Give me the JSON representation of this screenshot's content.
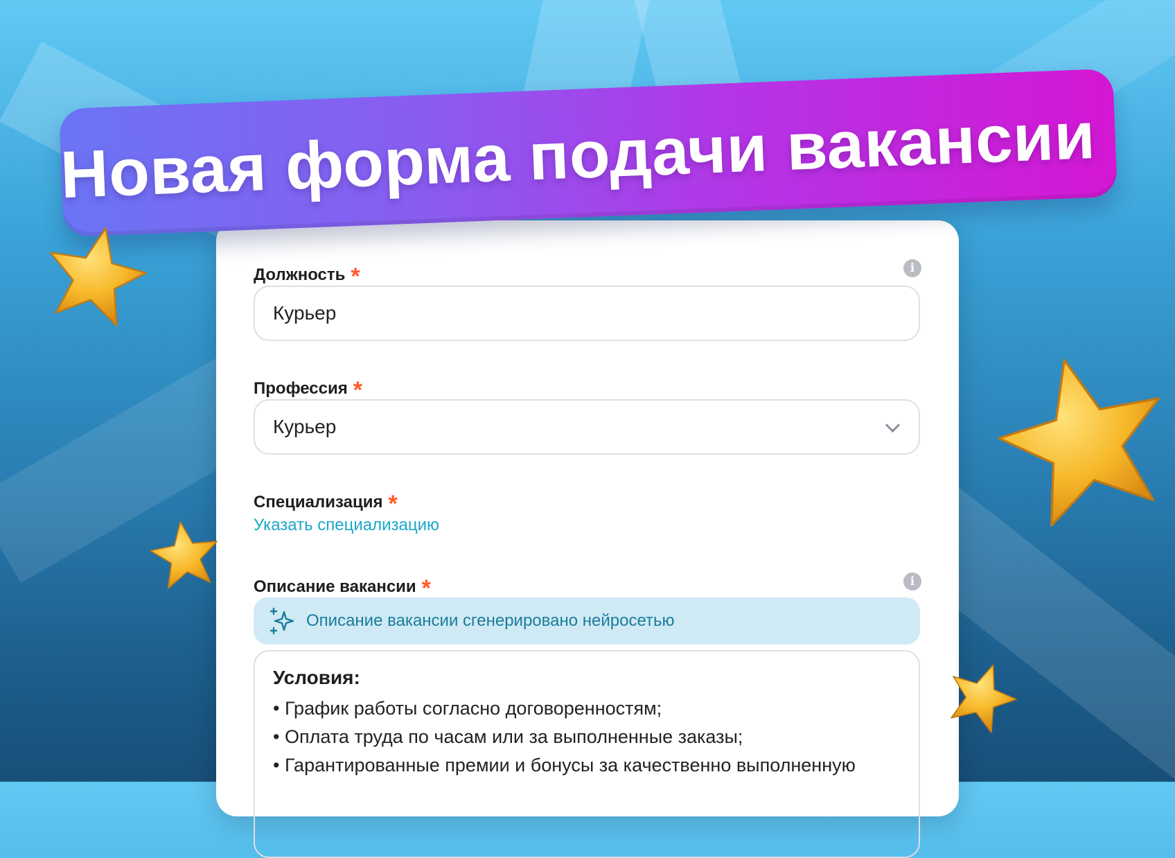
{
  "headline": "Новая форма подачи вакансии",
  "form": {
    "position": {
      "label": "Должность",
      "required": "*",
      "value": "Курьер",
      "info_icon": "i"
    },
    "profession": {
      "label": "Профессия",
      "required": "*",
      "value": "Курьер"
    },
    "specialization": {
      "label": "Специализация",
      "required": "*",
      "link": "Указать специализацию"
    },
    "description": {
      "label": "Описание вакансии",
      "required": "*",
      "info_icon": "i",
      "ai_notice": "Описание вакансии сгенерировано нейросетью",
      "heading": "Условия:",
      "lines": [
        "• График работы согласно договоренностям;",
        "• Оплата труда по часам или за выполненные заказы;",
        "• Гарантированные премии и бонусы за качественно выполненную"
      ]
    }
  },
  "colors": {
    "banner_start": "#6b74f4",
    "banner_end": "#d417d3",
    "required_star": "#ff5a2a",
    "link": "#1aa6c9",
    "ai_notice_bg": "#cfeaf4",
    "star_fill": "#f7b92b"
  },
  "icons": {
    "info": "info-icon",
    "chevron": "chevron-down-icon",
    "ai": "sparkle-icon",
    "decor": "star-icon"
  }
}
